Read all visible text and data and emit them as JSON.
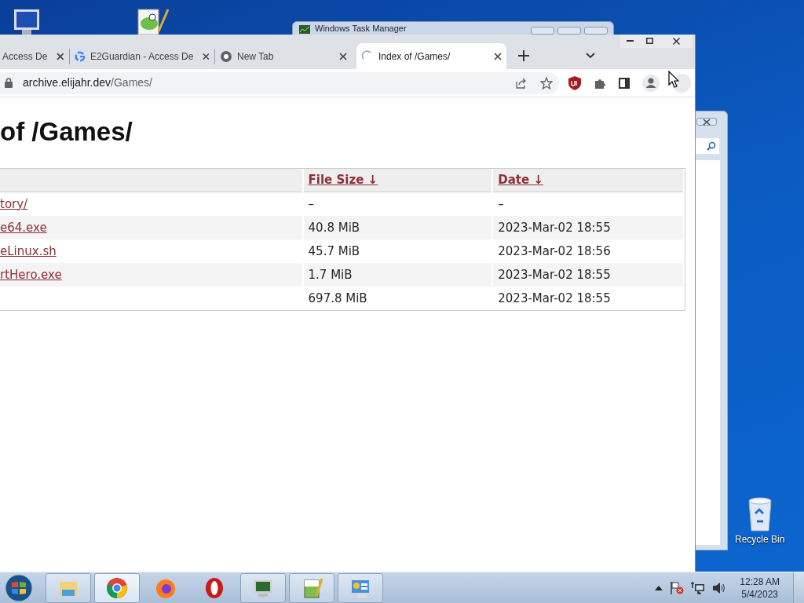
{
  "desktop_icons": [
    {
      "kind": "computer"
    },
    {
      "kind": "notepad"
    },
    {
      "kind": "recycle",
      "label": "Recycle Bin"
    }
  ],
  "background_windows": [
    {
      "kind": "task_manager",
      "title": "Windows Task Manager"
    },
    {
      "kind": "search_panel"
    }
  ],
  "browser": {
    "tabs": [
      {
        "title": "Access De",
        "selected": false
      },
      {
        "title": "E2Guardian - Access De",
        "kind": "google",
        "selected": false
      },
      {
        "title": "New Tab",
        "kind": "chrome",
        "selected": false
      },
      {
        "title": "Index of /Games/",
        "kind": "loading",
        "selected": true
      }
    ],
    "address": {
      "host": "archive.elijahr.dev",
      "path": "/Games/"
    },
    "page": {
      "heading": "of /Games/",
      "columns": [
        {
          "label": "File Size ↓"
        },
        {
          "label": "Date ↓"
        }
      ],
      "rows": [
        {
          "name": "tory/",
          "size": "–",
          "date": "–"
        },
        {
          "name": "e64.exe",
          "size": "40.8 MiB",
          "date": "2023-Mar-02 18:55"
        },
        {
          "name": "eLinux.sh",
          "size": "45.7 MiB",
          "date": "2023-Mar-02 18:56"
        },
        {
          "name": "rtHero.exe",
          "size": "1.7 MiB",
          "date": "2023-Mar-02 18:55"
        },
        {
          "size": "697.8 MiB",
          "date": "2023-Mar-02 18:55"
        }
      ]
    }
  },
  "taskbar": {
    "items": [
      {
        "kind": "explorer",
        "running": true,
        "selected": false
      },
      {
        "kind": "chrome",
        "running": true,
        "selected": true
      },
      {
        "kind": "firefox",
        "running": false,
        "selected": false
      },
      {
        "kind": "opera",
        "running": false,
        "selected": false
      },
      {
        "kind": "task_manager",
        "running": true,
        "selected": false
      },
      {
        "kind": "notepad",
        "running": true,
        "selected": false
      },
      {
        "kind": "control_panel",
        "running": true,
        "selected": false
      }
    ],
    "clock": {
      "time": "12:28 AM",
      "date": "5/4/2023"
    }
  }
}
